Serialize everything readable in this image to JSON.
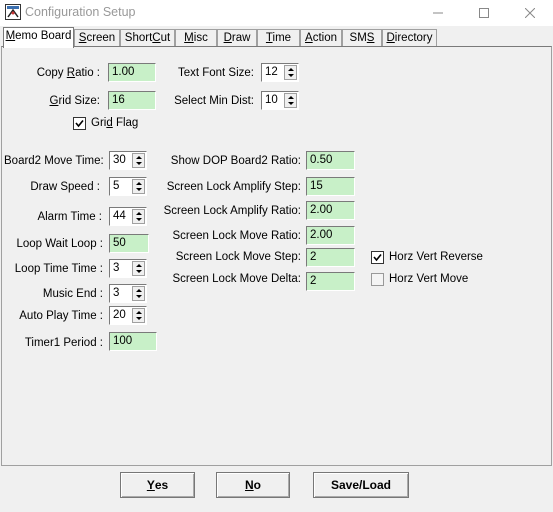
{
  "window": {
    "title": "Configuration Setup"
  },
  "tabs": [
    {
      "pre": "",
      "u": "M",
      "post": "emo Board"
    },
    {
      "pre": "",
      "u": "S",
      "post": "creen"
    },
    {
      "pre": "Short",
      "u": "C",
      "post": "ut"
    },
    {
      "pre": "",
      "u": "M",
      "post": "isc"
    },
    {
      "pre": "",
      "u": "D",
      "post": "raw"
    },
    {
      "pre": "",
      "u": "T",
      "post": "ime"
    },
    {
      "pre": "",
      "u": "A",
      "post": "ction"
    },
    {
      "pre": "SM",
      "u": "S",
      "post": ""
    },
    {
      "pre": "",
      "u": "D",
      "post": "irectory"
    }
  ],
  "fields": {
    "copy_ratio": {
      "pre": "Copy ",
      "u": "R",
      "post": "atio :",
      "value": "1.00"
    },
    "grid_size": {
      "pre": "",
      "u": "G",
      "post": "rid Size:",
      "value": "16"
    },
    "grid_flag": {
      "pre": "Gri",
      "u": "d",
      "post": " Flag",
      "checked": true
    },
    "text_font_size": {
      "label": "Text Font Size:",
      "value": "12"
    },
    "select_min_dist": {
      "label": "Select Min Dist:",
      "value": "10"
    },
    "board2_move_time": {
      "label": "Board2 Move Time:",
      "value": "30"
    },
    "draw_speed": {
      "label": "Draw Speed :",
      "value": "5"
    },
    "alarm_time": {
      "label": "Alarm Time :",
      "value": "44"
    },
    "loop_wait_loop": {
      "label": "Loop Wait Loop :",
      "value": "50"
    },
    "loop_time_time": {
      "label": "Loop Time Time :",
      "value": "3"
    },
    "music_end": {
      "label": "Music End :",
      "value": "3"
    },
    "auto_play_time": {
      "label": "Auto Play Time :",
      "value": "20"
    },
    "timer1_period": {
      "label": "Timer1 Period :",
      "value": "100"
    },
    "show_dop_board2_ratio": {
      "label": "Show DOP Board2 Ratio:",
      "value": "0.50"
    },
    "screen_lock_amplify_step": {
      "label": "Screen Lock Amplify Step:",
      "value": "15"
    },
    "screen_lock_amplify_ratio": {
      "label": "Screen Lock Amplify Ratio:",
      "value": "2.00"
    },
    "screen_lock_move_ratio": {
      "label": "Screen Lock Move Ratio:",
      "value": "2.00"
    },
    "screen_lock_move_step": {
      "label": "Screen Lock Move Step:",
      "value": "2"
    },
    "screen_lock_move_delta": {
      "label": "Screen Lock Move Delta:",
      "value": "2"
    },
    "horz_vert_reverse": {
      "label": "Horz Vert Reverse",
      "checked": true
    },
    "horz_vert_move": {
      "label": "Horz Vert Move",
      "checked": false
    }
  },
  "buttons": {
    "yes": {
      "u": "Y",
      "post": "es"
    },
    "no": {
      "u": "N",
      "post": "o"
    },
    "save_load": {
      "label": "Save/Load"
    }
  },
  "colors": {
    "field_bg": "#c8f0c8",
    "window_bg": "#f0f0f0"
  }
}
